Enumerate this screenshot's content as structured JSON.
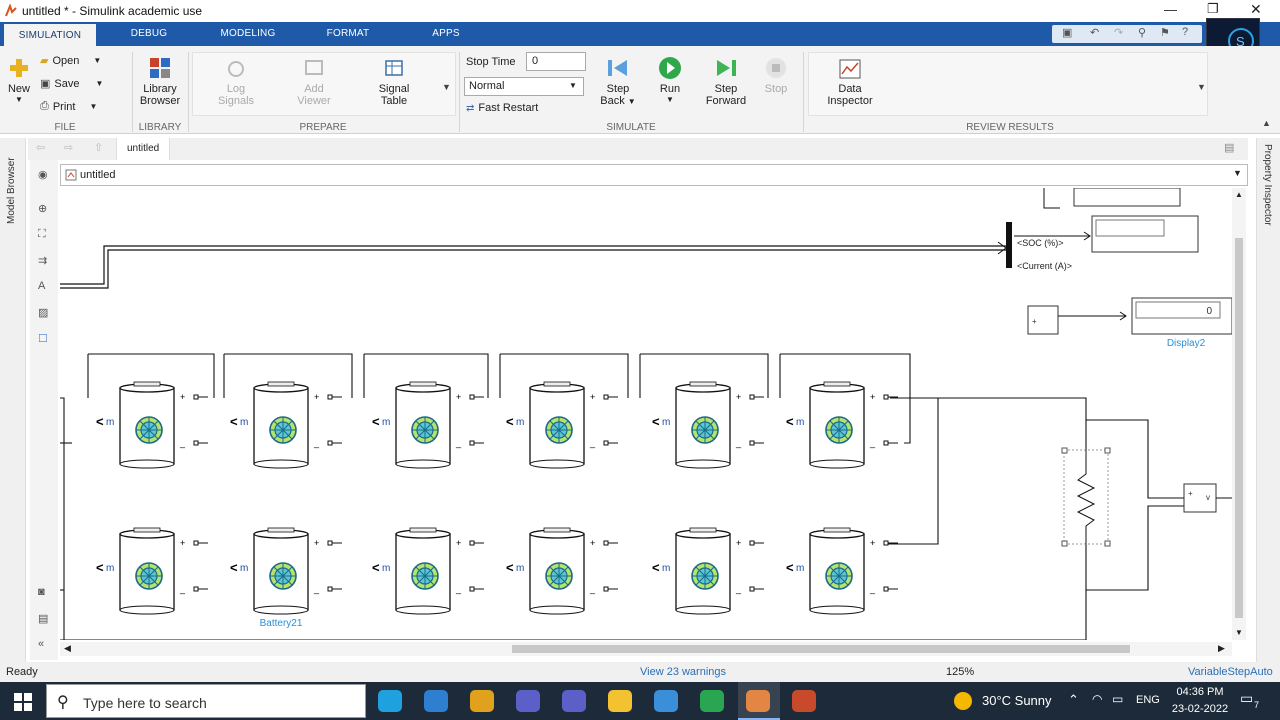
{
  "window": {
    "title": "untitled * - Simulink academic use"
  },
  "tabs": [
    {
      "label": "SIMULATION",
      "active": true
    },
    {
      "label": "DEBUG"
    },
    {
      "label": "MODELING"
    },
    {
      "label": "FORMAT"
    },
    {
      "label": "APPS"
    }
  ],
  "ribbon": {
    "file": {
      "new": "New",
      "open": "Open",
      "save": "Save",
      "print": "Print",
      "group": "FILE"
    },
    "library": {
      "browser_line1": "Library",
      "browser_line2": "Browser",
      "group": "LIBRARY"
    },
    "prepare": {
      "log_line1": "Log",
      "log_line2": "Signals",
      "add_line1": "Add",
      "add_line2": "Viewer",
      "signal_line1": "Signal",
      "signal_line2": "Table",
      "group": "PREPARE"
    },
    "simulate": {
      "stop_time_label": "Stop Time",
      "stop_time_value": "0",
      "mode_value": "Normal",
      "fast_restart": "Fast Restart",
      "step_back_line1": "Step",
      "step_back_line2": "Back",
      "run": "Run",
      "step_forward_line1": "Step",
      "step_forward_line2": "Forward",
      "stop": "Stop",
      "group": "SIMULATE"
    },
    "review": {
      "inspector_line1": "Data",
      "inspector_line2": "Inspector",
      "group": "REVIEW RESULTS"
    }
  },
  "nav": {
    "breadcrumb": "untitled",
    "address": "untitled"
  },
  "side": {
    "left_panel": "Model Browser",
    "right_panel": "Property Inspector"
  },
  "canvas": {
    "bus_labels": {
      "soc": "<SOC (%)>",
      "current": "<Current (A)>"
    },
    "display_value": "0",
    "display_name": "Display2",
    "battery_name": "Battery21",
    "port_m": "m",
    "plus": "+",
    "minus": "_"
  },
  "status": {
    "ready": "Ready",
    "warnings": "View 23 warnings",
    "zoom": "125%",
    "solver": "VariableStepAuto"
  },
  "taskbar": {
    "search_placeholder": "Type here to search",
    "weather": "30°C  Sunny",
    "lang": "ENG",
    "time": "04:36 PM",
    "date": "23-02-2022",
    "notifications": "7"
  },
  "colors": {
    "accent": "#1f5aa8",
    "link": "#2a8fd6",
    "taskbar": "#1c2a3a"
  }
}
